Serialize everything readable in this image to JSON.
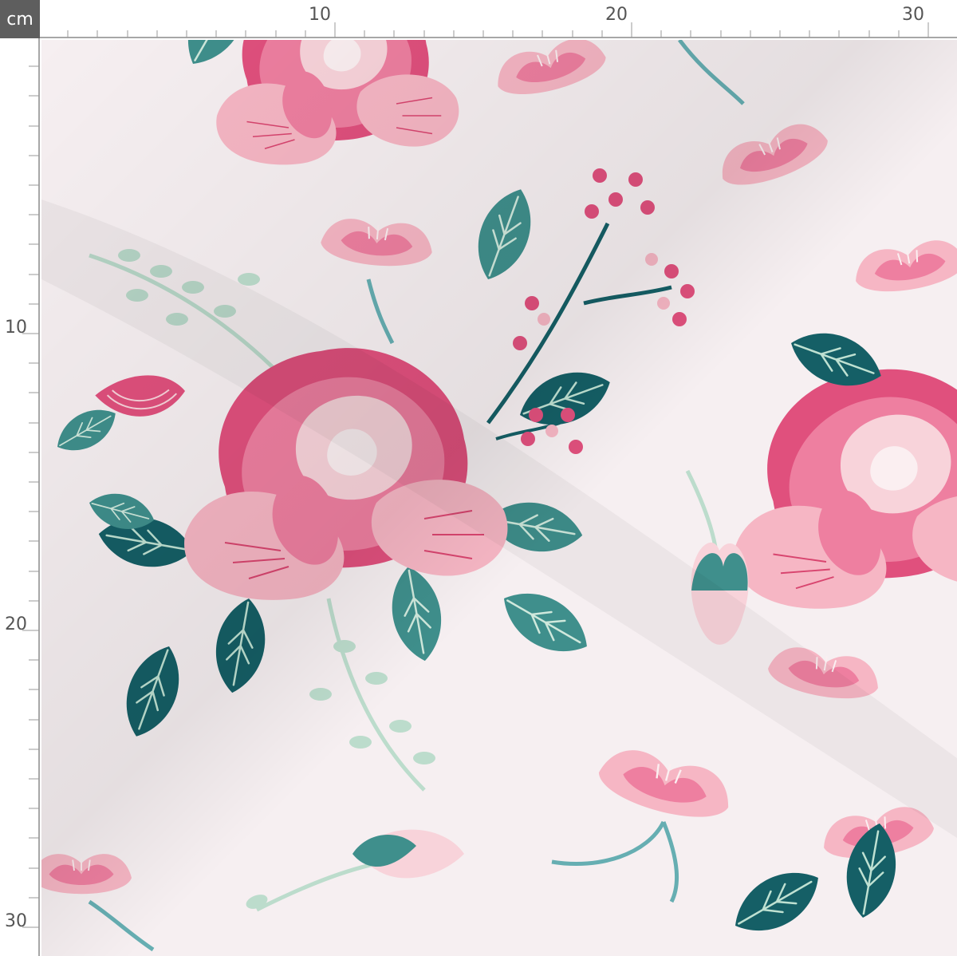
{
  "ruler": {
    "unit": "cm",
    "top_labels": [
      "10",
      "20",
      "30"
    ],
    "left_labels": [
      "10",
      "20",
      "30"
    ]
  },
  "fabric": {
    "pattern": "floral",
    "background_color": "#f6eff1",
    "colors": {
      "hot_pink": "#e0507d",
      "mid_pink": "#ee7fa0",
      "light_pink": "#f6b6c4",
      "pale_pink": "#f8d3da",
      "dark_teal": "#155f66",
      "teal": "#3f8f8c",
      "light_teal": "#66aeb2",
      "sage": "#bcdccc"
    }
  }
}
